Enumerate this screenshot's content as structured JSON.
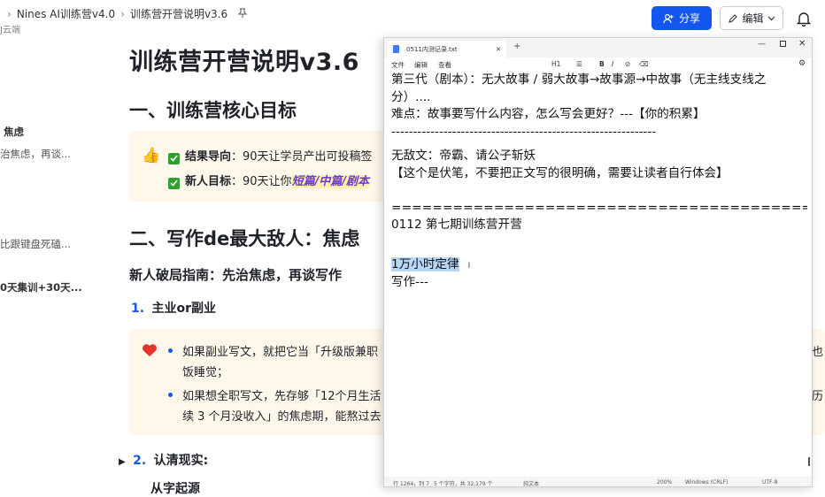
{
  "colors": {
    "accent": "#1456f0",
    "callout_bg": "#fff7ea",
    "check_green": "#2ea12e",
    "highlight_purple": "#6b3bd1",
    "selection": "#b8d6f5"
  },
  "header": {
    "breadcrumb": [
      "Nines AI训练营v4.0",
      "训练营开营说明v3.6"
    ],
    "pin_icon": "pin-icon",
    "sub_label": "J云端",
    "share_label": "分享",
    "edit_label": "编辑"
  },
  "outline": {
    "items": [
      "焦虑",
      "治焦虑，再谈...",
      "比跟键盘死磕...",
      "0天集训+30天..."
    ]
  },
  "doc": {
    "title": "训练营开营说明v3.6",
    "section1_heading": "一、训练营核心目标",
    "callout1": {
      "item1_label": "结果导向",
      "item1_text": "：90天让学员产出可投稿签",
      "item2_label": "新人目标",
      "item2_text": "：90天让你",
      "item2_highlight": "短篇/中篇/剧本"
    },
    "section2_heading": "二、写作de最大敌人：焦虑",
    "subheading": "新人破局指南：先治焦虑，再谈写作",
    "list1_num": "1.",
    "list1_label": "主业or副业",
    "callout2": {
      "bullet1_line1": "如果副业写文，就把它当「升级版兼职",
      "bullet1_line1_tail": "别也",
      "bullet1_line2": "饭睡觉；",
      "bullet2_line1": "如果想全职写文，先存够「12个月生活",
      "bullet2_line1_tail": "经历",
      "bullet2_line2": "续 3 个月没收入」的焦虑期，能熬过去"
    },
    "list2_num": "2.",
    "list2_label": "认清现实:",
    "list3_partial": "从字起源"
  },
  "notepad": {
    "tab_title": "0511内测记录.txt",
    "menu": [
      "文件",
      "编辑",
      "查看"
    ],
    "toolbar": [
      "H1",
      "☰",
      "B",
      "I",
      "⊘",
      "⌫"
    ],
    "lines": [
      "第三代（剧本）：无大故事 / 弱大故事→故事源→中故事（无主线支线之",
      "分）....",
      "难点：故事要写什么内容，怎么写会更好？---【你的积累】",
      "-------------------------------------------------------------",
      "无敌文：帝霸、请公子斩妖",
      "【这个是伏笔，不要把正文写的很明确，需要让读者自行体会】",
      "",
      "=========================================",
      "0112  第七期训练营开营",
      "",
      "1万小时定律",
      "写作---"
    ],
    "status": {
      "position": "行 1264，列 7",
      "chars": "5 个字符，共 32,179 个",
      "format": "纯文本",
      "zoom": "200%",
      "line_ending": "Windows (CRLF)",
      "encoding": "UTF-8"
    }
  }
}
